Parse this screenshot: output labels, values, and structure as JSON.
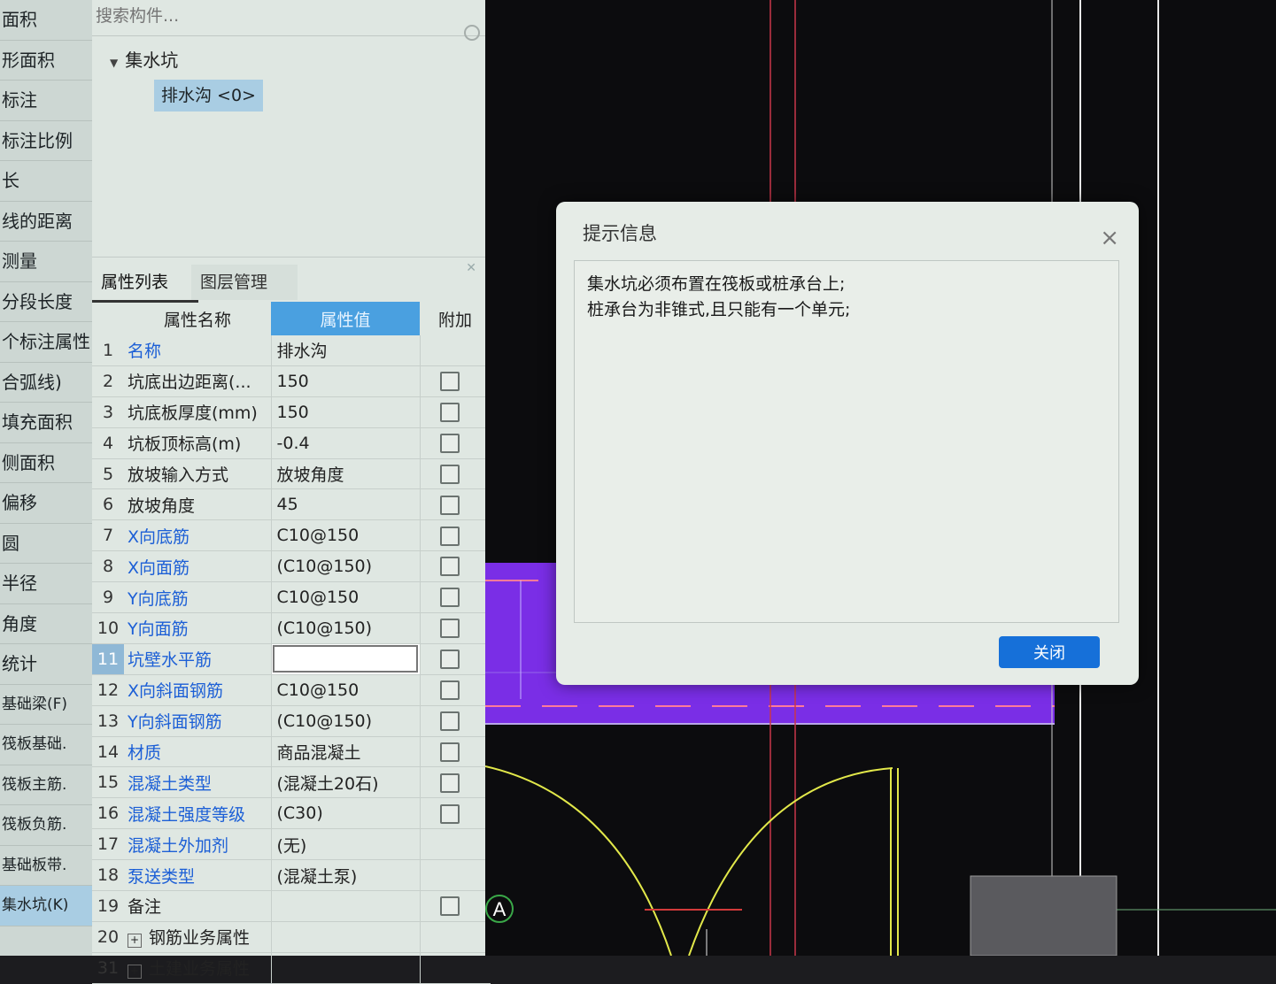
{
  "left_sidebar": {
    "items": [
      "面积",
      "形面积",
      "标注",
      "标注比例",
      "长",
      "线的距离",
      "测量",
      "分段长度",
      "个标注属性",
      "合弧线)",
      "填充面积",
      "侧面积",
      "偏移",
      "圆",
      "半径",
      "角度",
      "统计",
      "基础梁(F)",
      "筏板基础.",
      "筏板主筋.",
      "筏板负筋.",
      "基础板带.",
      "集水坑(K)"
    ]
  },
  "search": {
    "placeholder": "搜索构件..."
  },
  "tree": {
    "parent": "集水坑",
    "child": "排水沟 <0>"
  },
  "tabs": [
    "属性列表",
    "图层管理"
  ],
  "table": {
    "headers": {
      "name": "属性名称",
      "value": "属性值",
      "extra": "附加"
    },
    "rows": [
      {
        "num": "1",
        "name": "名称",
        "value": "排水沟",
        "blue": true,
        "check": false
      },
      {
        "num": "2",
        "name": "坑底出边距离(...",
        "value": "150",
        "blue": false,
        "check": true
      },
      {
        "num": "3",
        "name": "坑底板厚度(mm)",
        "value": "150",
        "blue": false,
        "check": true
      },
      {
        "num": "4",
        "name": "坑板顶标高(m)",
        "value": "-0.4",
        "blue": false,
        "check": true
      },
      {
        "num": "5",
        "name": "放坡输入方式",
        "value": "放坡角度",
        "blue": false,
        "check": true
      },
      {
        "num": "6",
        "name": "放坡角度",
        "value": "45",
        "blue": false,
        "check": true
      },
      {
        "num": "7",
        "name": "X向底筋",
        "value": "C10@150",
        "blue": true,
        "check": true
      },
      {
        "num": "8",
        "name": "X向面筋",
        "value": "(C10@150)",
        "blue": true,
        "check": true
      },
      {
        "num": "9",
        "name": "Y向底筋",
        "value": "C10@150",
        "blue": true,
        "check": true
      },
      {
        "num": "10",
        "name": "Y向面筋",
        "value": "(C10@150)",
        "blue": true,
        "check": true
      },
      {
        "num": "11",
        "name": "坑壁水平筋",
        "value": "",
        "blue": true,
        "check": true,
        "selected": true
      },
      {
        "num": "12",
        "name": "X向斜面钢筋",
        "value": "C10@150",
        "blue": true,
        "check": true
      },
      {
        "num": "13",
        "name": "Y向斜面钢筋",
        "value": "(C10@150)",
        "blue": true,
        "check": true
      },
      {
        "num": "14",
        "name": "材质",
        "value": "商品混凝土",
        "blue": true,
        "check": true
      },
      {
        "num": "15",
        "name": "混凝土类型",
        "value": "(混凝土20石)",
        "blue": true,
        "check": true
      },
      {
        "num": "16",
        "name": "混凝土强度等级",
        "value": "(C30)",
        "blue": true,
        "check": true
      },
      {
        "num": "17",
        "name": "混凝土外加剂",
        "value": "(无)",
        "blue": true,
        "check": false
      },
      {
        "num": "18",
        "name": "泵送类型",
        "value": "(混凝土泵)",
        "blue": true,
        "check": false
      },
      {
        "num": "19",
        "name": "备注",
        "value": "",
        "blue": false,
        "check": true
      },
      {
        "num": "20",
        "name": "钢筋业务属性",
        "value": "",
        "blue": false,
        "check": false,
        "expand": true
      },
      {
        "num": "31",
        "name": "土建业务属性",
        "value": "",
        "blue": false,
        "check": false,
        "expand": true
      }
    ]
  },
  "dialog": {
    "title": "提示信息",
    "lines": [
      "集水坑必须布置在筏板或桩承台上;",
      "桩承台为非锥式,且只能有一个单元;"
    ],
    "close_button": "关闭"
  },
  "cad": {
    "axis_label": "A",
    "colors": {
      "background": "#0c0c0e",
      "purple": "#7a2ee6",
      "yellow": "#e2e84a",
      "red": "#d23a3a"
    }
  }
}
